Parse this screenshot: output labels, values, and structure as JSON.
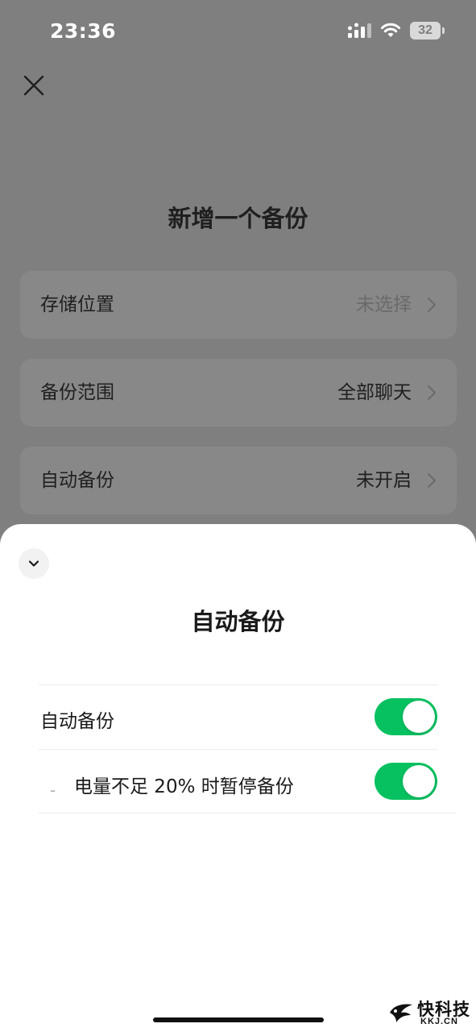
{
  "status_bar": {
    "time": "23:36",
    "battery": "32",
    "signal_icon": "signal-icon",
    "wifi_icon": "wifi-icon"
  },
  "background_page": {
    "title": "新增一个备份",
    "rows": [
      {
        "label": "存储位置",
        "value": "未选择"
      },
      {
        "label": "备份范围",
        "value": "全部聊天"
      },
      {
        "label": "自动备份",
        "value": "未开启"
      }
    ]
  },
  "sheet": {
    "title": "自动备份",
    "settings": [
      {
        "label": "自动备份",
        "enabled": true
      },
      {
        "label": "电量不足 20% 时暂停备份",
        "prefix": "-",
        "enabled": true
      }
    ]
  },
  "watermark": {
    "text": "快科技",
    "sub": "KKJ.CN"
  },
  "colors": {
    "toggle_on": "#07c160",
    "overlay": "#7f7f7f",
    "sheet_bg": "#ffffff"
  }
}
